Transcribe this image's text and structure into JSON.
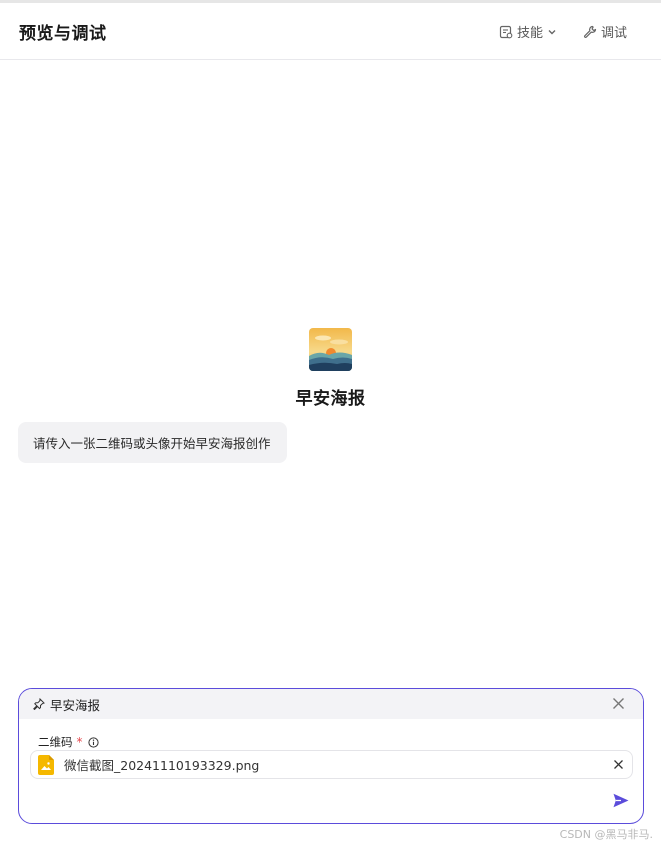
{
  "header": {
    "title": "预览与调试",
    "skills_label": "技能",
    "debug_label": "调试"
  },
  "agent": {
    "name": "早安海报",
    "avatar_icon": "sunrise-landscape-icon"
  },
  "messages": [
    {
      "text": "请传入一张二维码或头像开始早安海报创作"
    }
  ],
  "composer": {
    "plugin_name": "早安海报",
    "field_label": "二维码",
    "required_mark": "*",
    "file_name": "微信截图_20241110193329.png",
    "accent_color": "#5b4cdb"
  },
  "watermark": "CSDN @黑马非马."
}
